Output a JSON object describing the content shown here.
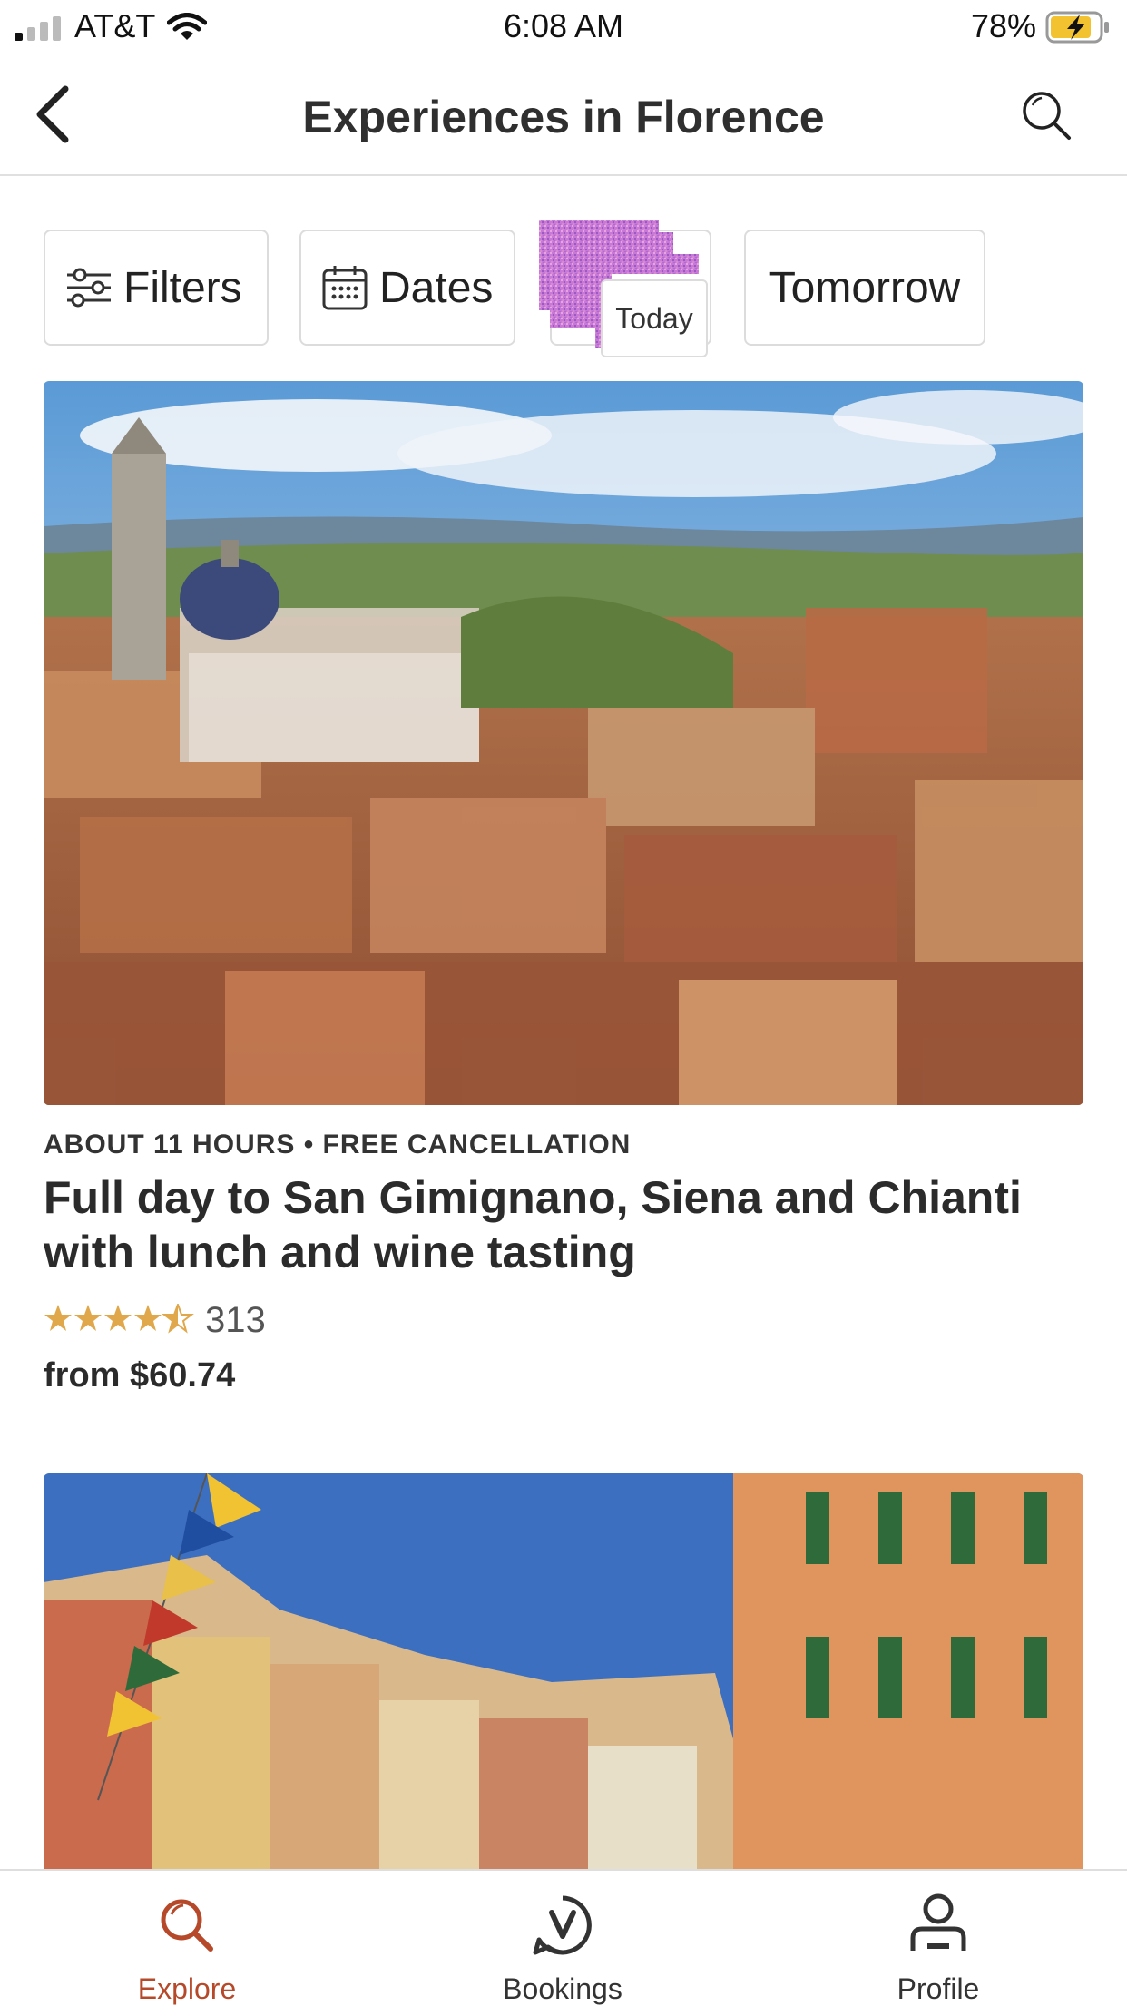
{
  "status_bar": {
    "carrier": "AT&T",
    "time": "6:08 AM",
    "battery": "78%"
  },
  "header": {
    "title": "Experiences in Florence",
    "back_icon": "chevron-left-icon",
    "search_icon": "search-icon"
  },
  "filters": {
    "filters_label": "Filters",
    "dates_label": "Dates",
    "today_label": "Today",
    "tomorrow_label": "Tomorrow"
  },
  "card": {
    "meta": "ABOUT 11 HOURS • FREE CANCELLATION",
    "title": "Full day to San Gimignano, Siena and Chianti with lunch and wine tasting",
    "rating": 4.5,
    "rating_count": "313",
    "price": "from $60.74"
  },
  "tabbar": {
    "explore": "Explore",
    "bookings": "Bookings",
    "profile": "Profile",
    "active_color": "#b5492a",
    "star_color": "#e0a84a"
  }
}
